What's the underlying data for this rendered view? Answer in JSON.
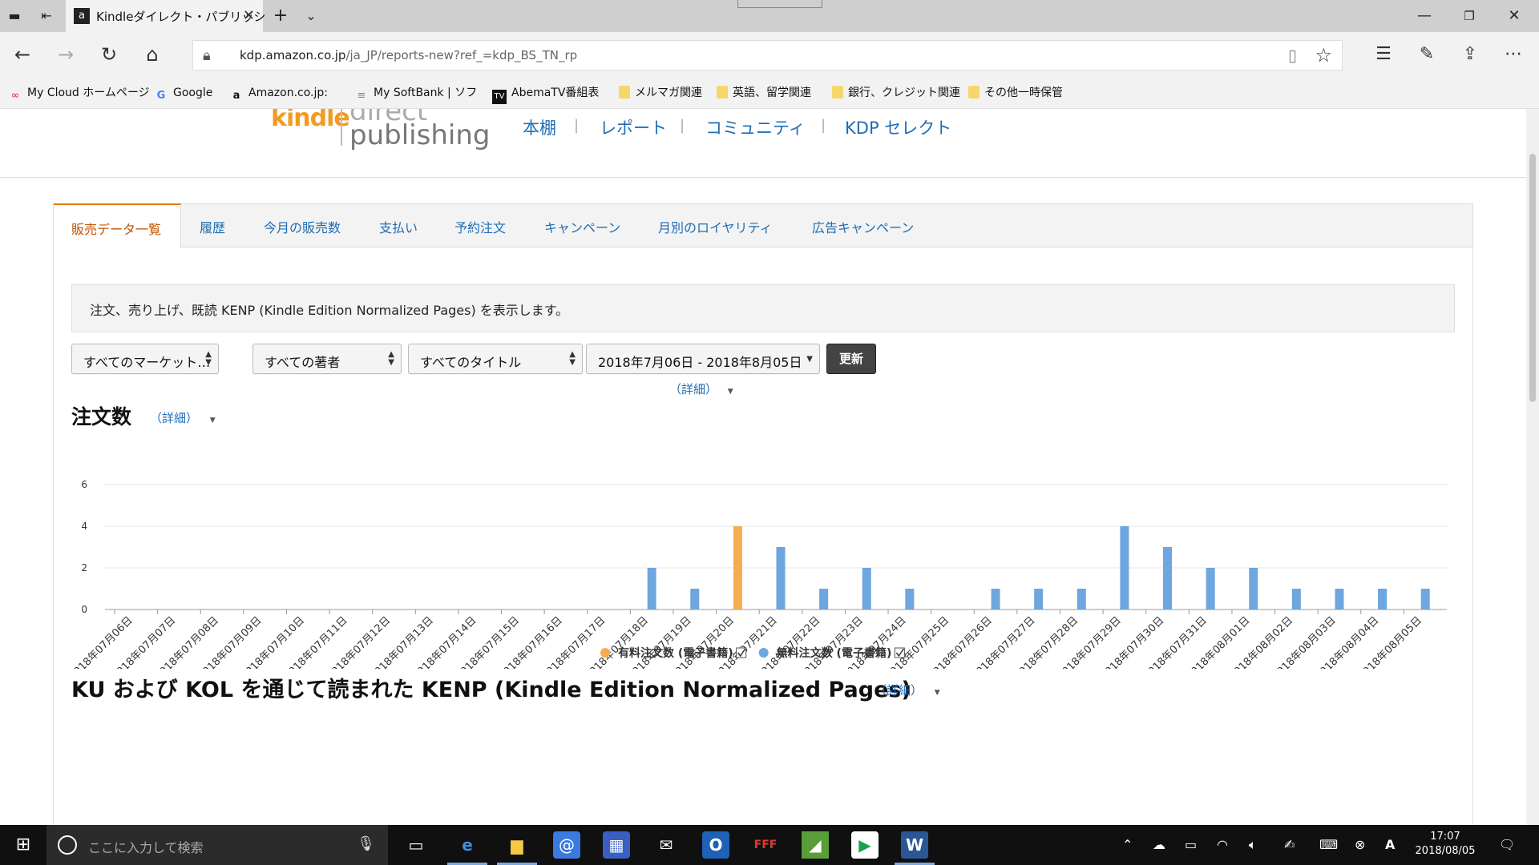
{
  "browser": {
    "tab_title": "Kindleダイレクト・パブリッシ",
    "url_host": "kdp.amazon.co.jp",
    "url_path": "/ja_JP/reports-new?ref_=kdp_BS_TN_rp",
    "favorites": [
      {
        "label": "My Cloud ホームページ",
        "icon": "cloud-icon"
      },
      {
        "label": "Google",
        "icon": "google-icon"
      },
      {
        "label": "Amazon.co.jp:",
        "icon": "amazon-icon"
      },
      {
        "label": "My SoftBank | ソフ",
        "icon": "page-icon"
      },
      {
        "label": "AbemaTV番組表",
        "icon": "tv-icon"
      },
      {
        "label": "メルマガ関連",
        "icon": "folder-icon"
      },
      {
        "label": "英語、留学関連",
        "icon": "folder-icon"
      },
      {
        "label": "銀行、クレジット関連",
        "icon": "folder-icon"
      },
      {
        "label": "その他一時保管",
        "icon": "folder-icon"
      }
    ]
  },
  "kdp": {
    "logo_word": "kindle",
    "logo_line1": "direct",
    "logo_line2": "publishing",
    "nav": [
      "本棚",
      "レポート",
      "コミュニティ",
      "KDP セレクト"
    ]
  },
  "report_tabs": {
    "active": "販売データ一覧",
    "others": [
      "履歴",
      "今月の販売数",
      "支払い",
      "予約注文",
      "キャンペーン",
      "月別のロイヤリティ",
      "広告キャンペーン"
    ]
  },
  "info_text": "注文、売り上げ、既読 KENP (Kindle Edition Normalized Pages) を表示します。",
  "filters": {
    "market": "すべてのマーケット…",
    "author": "すべての著者",
    "title": "すべてのタイトル",
    "date_range": "2018年7月06日 - 2018年8月05日",
    "update_label": "更新",
    "date_detail": "（詳細）"
  },
  "orders_section": {
    "title": "注文数",
    "detail_label": "（詳細）"
  },
  "chart_data": {
    "type": "bar",
    "title": "注文数",
    "ylim": [
      0,
      6
    ],
    "yticks": [
      0,
      2,
      4,
      6
    ],
    "grid": true,
    "legend_position": "bottom",
    "categories": [
      "2018年07月06日",
      "2018年07月07日",
      "2018年07月08日",
      "2018年07月09日",
      "2018年07月10日",
      "2018年07月11日",
      "2018年07月12日",
      "2018年07月13日",
      "2018年07月14日",
      "2018年07月15日",
      "2018年07月16日",
      "2018年07月17日",
      "2018年07月18日",
      "2018年07月19日",
      "2018年07月20日",
      "2018年07月21日",
      "2018年07月22日",
      "2018年07月23日",
      "2018年07月24日",
      "2018年07月25日",
      "2018年07月26日",
      "2018年07月27日",
      "2018年07月28日",
      "2018年07月29日",
      "2018年07月30日",
      "2018年07月31日",
      "2018年08月01日",
      "2018年08月02日",
      "2018年08月03日",
      "2018年08月04日",
      "2018年08月05日"
    ],
    "series": [
      {
        "name": "有料注文数 (電子書籍)",
        "color": "#f7ac50",
        "values": [
          0,
          0,
          0,
          0,
          0,
          0,
          0,
          0,
          0,
          0,
          0,
          0,
          0,
          0,
          4,
          0,
          0,
          0,
          0,
          0,
          0,
          0,
          0,
          0,
          0,
          0,
          0,
          0,
          0,
          0,
          0
        ]
      },
      {
        "name": "無料注文数 (電子書籍)",
        "color": "#6ea6df",
        "values": [
          0,
          0,
          0,
          0,
          0,
          0,
          0,
          0,
          0,
          0,
          0,
          0,
          2,
          1,
          0,
          3,
          1,
          2,
          1,
          0,
          1,
          1,
          1,
          4,
          3,
          2,
          2,
          1,
          1,
          1,
          1
        ]
      }
    ]
  },
  "kenp_section": {
    "title": "KU および KOL を通じて読まれた KENP (Kindle Edition Normalized Pages)",
    "detail_label": "（詳細）"
  },
  "taskbar": {
    "search_placeholder": "ここに入力して検索",
    "time": "17:07",
    "date": "2018/08/05"
  }
}
